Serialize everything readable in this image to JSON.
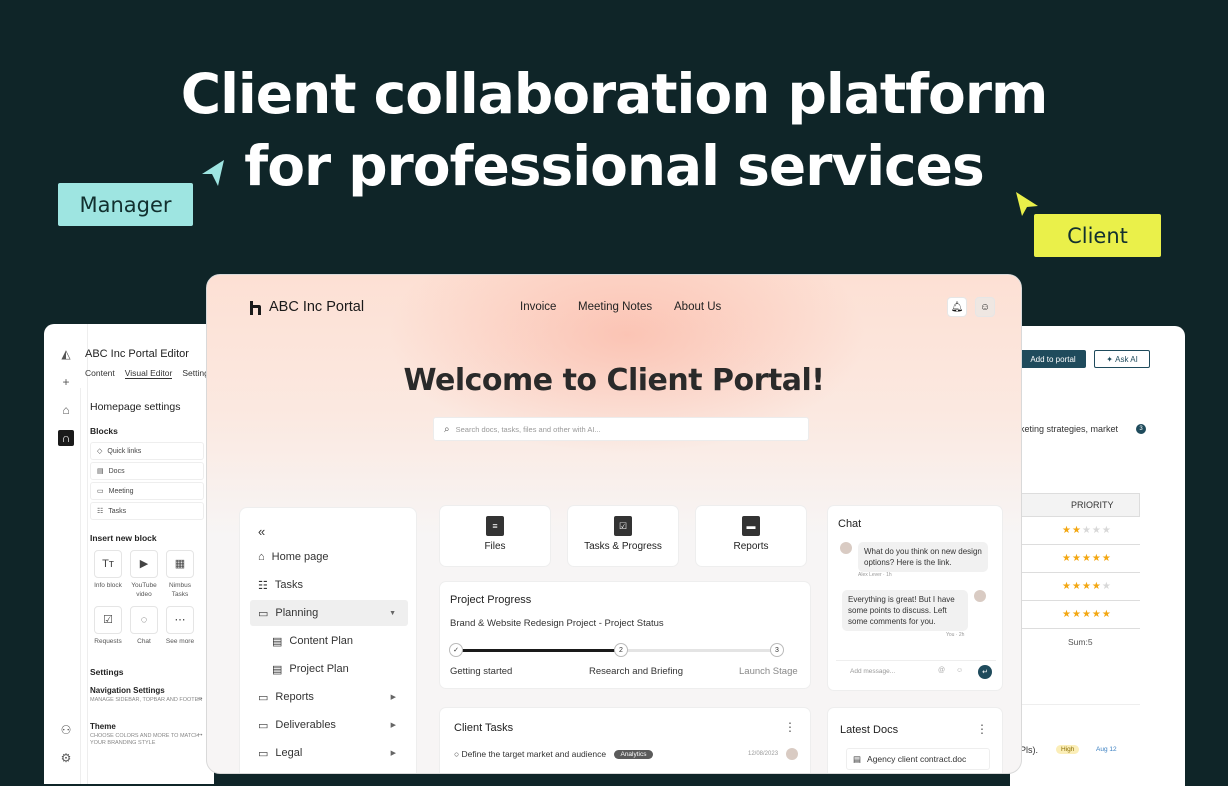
{
  "hero": {
    "line1": "Client collaboration platform",
    "line2": "for professional services"
  },
  "tags": {
    "manager": "Manager",
    "client": "Client"
  },
  "colors": {
    "background": "#0f2528",
    "manager_tag": "#9ee5e1",
    "client_tag": "#eaf04a",
    "accent": "#1f4b5c"
  },
  "editor": {
    "title": "ABC Inc Portal Editor",
    "tabs": [
      "Content",
      "Visual Editor",
      "Settings"
    ],
    "heading": "Homepage settings",
    "blocks_label": "Blocks",
    "blocks": [
      "Quick links",
      "Docs",
      "Meeting",
      "Tasks"
    ],
    "insert_label": "Insert new block",
    "insert_blocks": [
      {
        "label": "Info block",
        "icon": "text-icon"
      },
      {
        "label": "YouTube video",
        "icon": "play-icon"
      },
      {
        "label": "Nimbus Tasks",
        "icon": "grid-icon"
      },
      {
        "label": "Requests",
        "icon": "check-icon"
      },
      {
        "label": "Chat",
        "icon": "chat-icon"
      },
      {
        "label": "See more",
        "icon": "more-icon"
      }
    ],
    "settings_label": "Settings",
    "nav_settings": {
      "title": "Navigation Settings",
      "desc": "Manage sidebar, topbar and footer"
    },
    "theme": {
      "title": "Theme",
      "desc": "Choose colors and more to match your branding style"
    }
  },
  "right_panel": {
    "add_button": "Add to portal",
    "ask_button": "Ask AI",
    "text": "keting strategies, market",
    "badge": "3",
    "table_header": "PRIORITY",
    "ratings": [
      2,
      5,
      4,
      5
    ],
    "sum": "Sum:5",
    "bottom_text": "Pls).",
    "bottom_badge": "High",
    "bottom_date": "Aug 12"
  },
  "portal": {
    "logo": "ABC Inc Portal",
    "nav": [
      "Invoice",
      "Meeting Notes",
      "About Us"
    ],
    "welcome": "Welcome to Client Portal!",
    "search_placeholder": "Search docs, tasks, files and other with AI...",
    "sidebar": [
      {
        "label": "Home page",
        "icon": "home-icon"
      },
      {
        "label": "Tasks",
        "icon": "tasks-icon"
      },
      {
        "label": "Planning",
        "icon": "folder-icon"
      },
      {
        "label": "Content Plan",
        "icon": "doc-icon"
      },
      {
        "label": "Project Plan",
        "icon": "doc-icon"
      },
      {
        "label": "Reports",
        "icon": "folder-icon"
      },
      {
        "label": "Deliverables",
        "icon": "folder-icon"
      },
      {
        "label": "Legal",
        "icon": "folder-icon"
      }
    ],
    "quick_links": [
      "Files",
      "Tasks & Progress",
      "Reports"
    ],
    "progress": {
      "title": "Project Progress",
      "subtitle": "Brand & Website Redesign Project - Project Status",
      "steps": [
        "Getting started",
        "Research and Briefing",
        "Launch Stage"
      ],
      "step_numbers": [
        "2",
        "3"
      ],
      "completion": 0.5
    },
    "tasks": {
      "title": "Client Tasks",
      "first_task": "Define the target market and audience",
      "first_tag": "Analytics",
      "first_date": "12/08/2023"
    },
    "chat": {
      "title": "Chat",
      "msg1": "What do you think on new design options? Here is the link.",
      "msg1_meta": "Alex Lever · 1h",
      "msg2": "Everything is great! But I have some points to discuss. Left some comments for you.",
      "msg2_meta": "You · 2h",
      "input_placeholder": "Add message..."
    },
    "docs": {
      "title": "Latest Docs",
      "first_doc": "Agency client contract.doc"
    }
  }
}
